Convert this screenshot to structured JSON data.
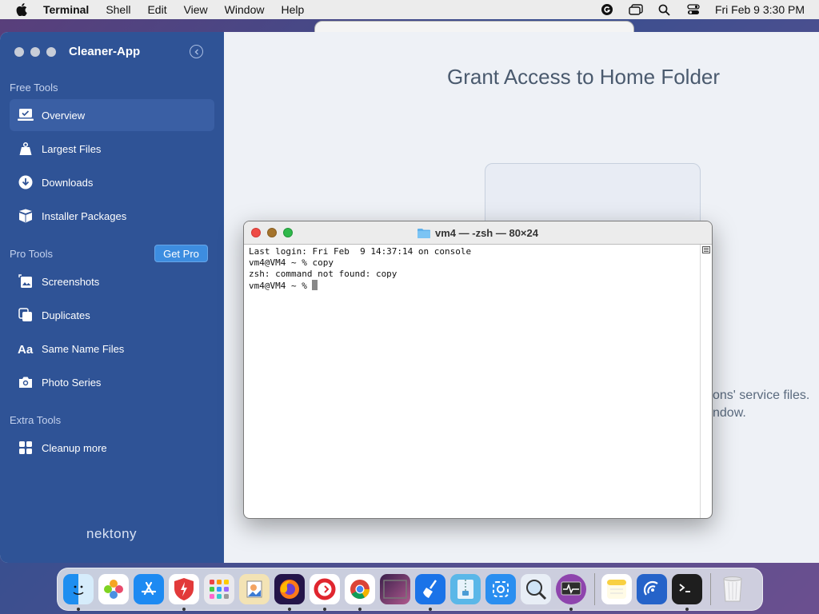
{
  "menubar": {
    "app_name": "Terminal",
    "items": [
      "Shell",
      "Edit",
      "View",
      "Window",
      "Help"
    ],
    "clock": "Fri Feb 9  3:30 PM"
  },
  "sidebar": {
    "app_title": "Cleaner-App",
    "sections": {
      "free": "Free Tools",
      "pro": "Pro Tools",
      "extra": "Extra Tools"
    },
    "free_items": [
      {
        "label": "Overview",
        "icon": "laptop-check-icon"
      },
      {
        "label": "Largest Files",
        "icon": "weight-icon"
      },
      {
        "label": "Downloads",
        "icon": "download-icon"
      },
      {
        "label": "Installer Packages",
        "icon": "box-icon"
      }
    ],
    "get_pro": "Get Pro",
    "pro_items": [
      {
        "label": "Screenshots",
        "icon": "screenshot-icon"
      },
      {
        "label": "Duplicates",
        "icon": "duplicates-icon"
      },
      {
        "label": "Same Name Files",
        "icon": "text-aa-icon"
      },
      {
        "label": "Photo Series",
        "icon": "camera-icon"
      }
    ],
    "extra_items": [
      {
        "label": "Cleanup more",
        "icon": "grid-icon"
      }
    ],
    "brand": "nektony"
  },
  "main": {
    "title": "Grant Access to Home Folder",
    "partial_line1": "ons' service files.",
    "partial_line2": "ndow."
  },
  "terminal": {
    "title": "vm4 — -zsh — 80×24",
    "lines": [
      "Last login: Fri Feb  9 14:37:14 on console",
      "vm4@VM4 ~ % copy",
      "zsh: command not found: copy",
      "vm4@VM4 ~ % "
    ]
  },
  "dock": {
    "apps": [
      "Finder",
      "Launchpad Pinwheel",
      "App Store",
      "Security",
      "Launchpad",
      "Preview",
      "Firefox",
      "Opera",
      "Chrome",
      "Photo Booth",
      "Cleaner",
      "Archive Utility",
      "Screenshot",
      "Directory Utility",
      "Activity Monitor",
      "Notes",
      "Network Radar",
      "Terminal",
      "Trash"
    ]
  },
  "colors": {
    "sidebar": "#2f5396",
    "accent": "#3d8de0",
    "close": "#ee4b45",
    "minimize": "#a4732c",
    "maximize": "#2fb84a"
  }
}
